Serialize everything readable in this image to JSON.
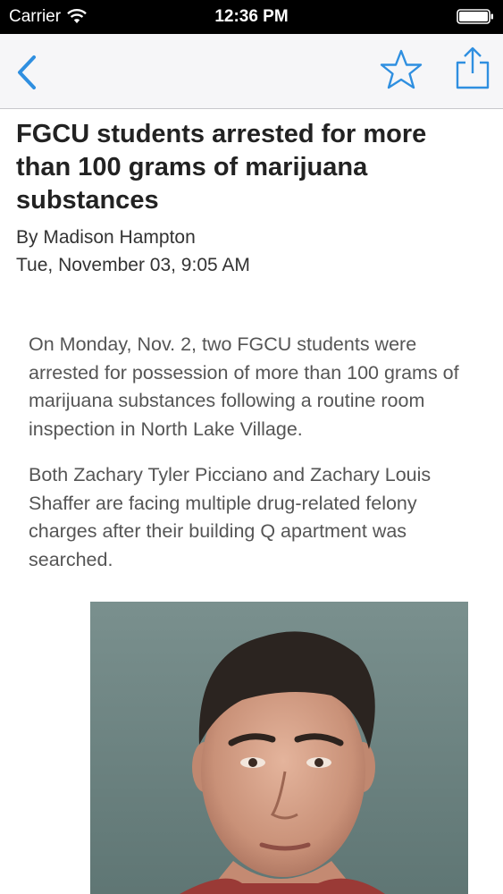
{
  "status_bar": {
    "carrier": "Carrier",
    "time": "12:36 PM",
    "wifi_icon": "wifi-icon",
    "battery_icon": "battery-full-icon"
  },
  "nav": {
    "back_icon": "chevron-left-icon",
    "favorite_icon": "star-icon",
    "share_icon": "share-icon",
    "accent_color": "#2f8fe0"
  },
  "article": {
    "headline": "FGCU students arrested for more than 100 grams of marijuana substances",
    "author": "By Madison Hampton",
    "date": "Tue, November 03, 9:05 AM",
    "paragraphs": [
      "On Monday, Nov. 2, two FGCU students were arrested for possession of more than 100 grams of marijuana substances following a routine room inspection in North Lake Village.",
      "Both Zachary Tyler Picciano and Zachary Louis Shaffer are facing multiple drug-related felony charges after their building Q apartment was searched."
    ]
  }
}
